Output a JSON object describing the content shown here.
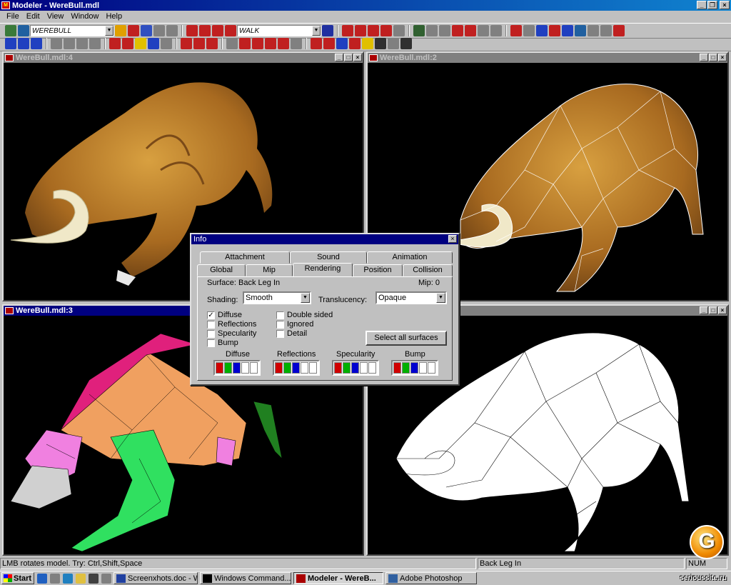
{
  "window": {
    "title": "Modeler - WereBull.mdl"
  },
  "menu": [
    "File",
    "Edit",
    "View",
    "Window",
    "Help"
  ],
  "toolbar": {
    "model_combo": "WEREBULL",
    "animation_combo": "WALK"
  },
  "viewports": [
    {
      "title": "WereBull.mdl:4",
      "mode": "textured"
    },
    {
      "title": "WereBull.mdl:2",
      "mode": "textured-wireframe"
    },
    {
      "title": "WereBull.mdl:3",
      "mode": "surface-colored"
    },
    {
      "title": "",
      "mode": "white-wireframe"
    }
  ],
  "info_dialog": {
    "title": "Info",
    "tabs_back": [
      "Attachment",
      "Sound",
      "Animation"
    ],
    "tabs_front": [
      "Global",
      "Mip",
      "Rendering",
      "Position",
      "Collision"
    ],
    "active_tab": "Rendering",
    "surface_label": "Surface: Back Leg In",
    "mip_label": "Mip: 0",
    "shading_label": "Shading:",
    "shading_value": "Smooth",
    "translucency_label": "Translucency:",
    "translucency_value": "Opaque",
    "checkboxes_left": [
      {
        "label": "Diffuse",
        "checked": true
      },
      {
        "label": "Reflections",
        "checked": false
      },
      {
        "label": "Specularity",
        "checked": false
      },
      {
        "label": "Bump",
        "checked": false
      }
    ],
    "checkboxes_right": [
      {
        "label": "Double sided",
        "checked": false
      },
      {
        "label": "Ignored",
        "checked": false
      },
      {
        "label": "Detail",
        "checked": false
      }
    ],
    "select_all_button": "Select all surfaces",
    "swatch_groups": [
      "Diffuse",
      "Reflections",
      "Specularity",
      "Bump"
    ],
    "swatch_colors": [
      "#d00000",
      "#00b000",
      "#0000d0",
      "#ffffff",
      "#ffffff"
    ]
  },
  "status": {
    "hint": "LMB rotates model. Try: Ctrl,Shift,Space",
    "surface": "Back Leg In",
    "num": "NUM"
  },
  "taskbar": {
    "start": "Start",
    "items": [
      "Screenxhots.doc - W...",
      "Windows Command...",
      "Modeler - WereB...",
      "Adobe Photoshop"
    ],
    "active_index": 2
  },
  "watermark": "serioussite.ru",
  "logo_letter": "G",
  "colors": {
    "title_active": "#000080",
    "face": "#c0c0c0",
    "viewport_bg": "#000000"
  }
}
